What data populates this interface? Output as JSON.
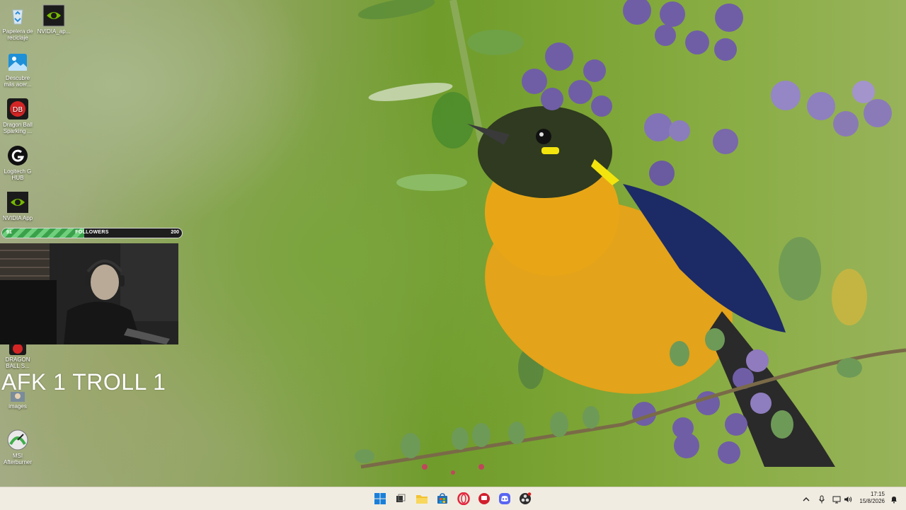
{
  "desktop": {
    "icons": [
      {
        "label": "Papelera de reciclaje",
        "icon": "recycle-bin-icon"
      },
      {
        "label": "NVIDIA_ap...",
        "icon": "nvidia-icon"
      },
      {
        "label": "Descubre más acer...",
        "icon": "picture-icon"
      },
      {
        "label": "Dragon Ball Sparking ...",
        "icon": "dragon-ball-icon"
      },
      {
        "label": "Logitech G HUB",
        "icon": "logitech-icon"
      },
      {
        "label": "NVIDIA App",
        "icon": "nvidia-icon"
      },
      {
        "label": "DRAGON BALL S...",
        "icon": "dragon-ball-icon"
      },
      {
        "label": "images",
        "icon": "image-folder-icon"
      },
      {
        "label": "MSI Afterburner",
        "icon": "msi-afterburner-icon"
      }
    ]
  },
  "overlay": {
    "followers": {
      "current": "91",
      "label": "FOLLOWERS",
      "goal": "200",
      "progress": 0.455
    },
    "afk_text": "AFK 1 TROLL 1"
  },
  "taskbar": {
    "apps": [
      {
        "icon": "windows-start-icon"
      },
      {
        "icon": "task-view-icon"
      },
      {
        "icon": "file-explorer-icon"
      },
      {
        "icon": "microsoft-store-icon"
      },
      {
        "icon": "opera-gx-icon"
      },
      {
        "icon": "app-red-icon"
      },
      {
        "icon": "discord-icon"
      },
      {
        "icon": "obs-icon"
      }
    ],
    "tray": {
      "chevron": "chevron-up-icon",
      "mic": "microphone-icon",
      "network": "network-icon",
      "volume": "volume-icon",
      "notifications": "notification-icon"
    },
    "clock": {
      "time": "17:15",
      "date": "15/8/2026"
    }
  },
  "colors": {
    "accent_green": "#3aa14a",
    "taskbar_bg": "#f1ece1",
    "bird_yellow": "#e3a31a"
  }
}
